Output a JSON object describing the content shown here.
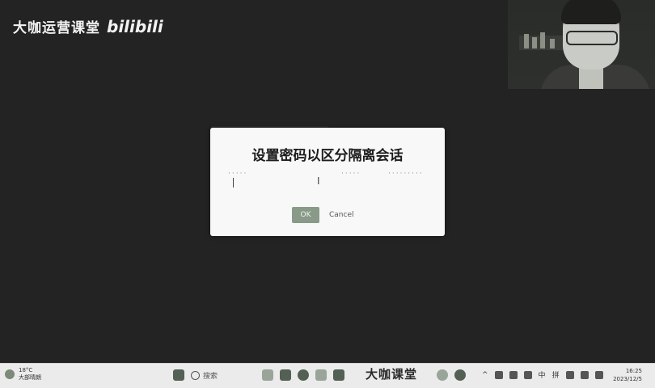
{
  "overlay": {
    "brand_text": "大咖运营课堂",
    "brand_logo": "bilibili"
  },
  "dialog": {
    "title": "设置密码以区分隔离会话",
    "password_dots_left": "·····",
    "password_dots_right": "·········",
    "ok_label": "OK",
    "cancel_label": "Cancel"
  },
  "taskbar": {
    "weather_temp": "18°C",
    "weather_desc": "大部晴朗",
    "search_placeholder": "搜索",
    "stamp_text": "大咖课堂",
    "ime_lang": "中",
    "ime_mode": "拼",
    "time": "16:25",
    "date": "2023/12/5"
  }
}
